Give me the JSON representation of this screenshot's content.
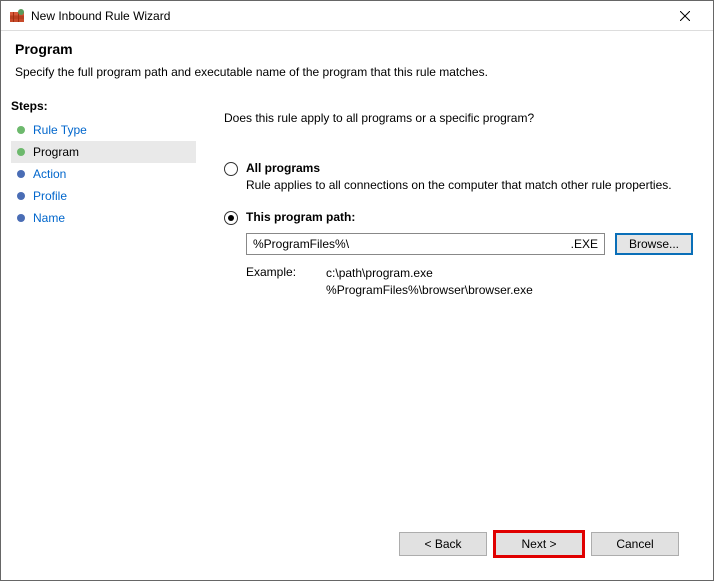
{
  "titlebar": {
    "title": "New Inbound Rule Wizard"
  },
  "header": {
    "title": "Program",
    "subtitle": "Specify the full program path and executable name of the program that this rule matches."
  },
  "sidebar": {
    "title": "Steps:",
    "items": [
      {
        "label": "Rule Type"
      },
      {
        "label": "Program"
      },
      {
        "label": "Action"
      },
      {
        "label": "Profile"
      },
      {
        "label": "Name"
      }
    ]
  },
  "main": {
    "question": "Does this rule apply to all programs or a specific program?",
    "option_all": {
      "label": "All programs",
      "desc": "Rule applies to all connections on the computer that match other rule properties."
    },
    "option_path": {
      "label": "This program path:",
      "value": "%ProgramFiles%\\",
      "ext": ".EXE",
      "browse": "Browse...",
      "example_label": "Example:",
      "example_line1": "c:\\path\\program.exe",
      "example_line2": "%ProgramFiles%\\browser\\browser.exe"
    }
  },
  "footer": {
    "back": "< Back",
    "next": "Next >",
    "cancel": "Cancel"
  }
}
